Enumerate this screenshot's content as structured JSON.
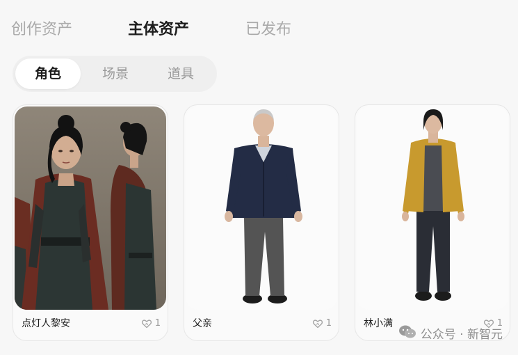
{
  "top_tabs": [
    {
      "label": "创作资产",
      "active": false
    },
    {
      "label": "主体资产",
      "active": true
    },
    {
      "label": "已发布",
      "active": false
    }
  ],
  "segments": [
    {
      "label": "角色",
      "active": true
    },
    {
      "label": "场景",
      "active": false
    },
    {
      "label": "道具",
      "active": false
    }
  ],
  "cards": [
    {
      "name": "点灯人黎安",
      "likes": "1",
      "icon": "heart-icon"
    },
    {
      "name": "父亲",
      "likes": "1",
      "icon": "heart-icon"
    },
    {
      "name": "林小满",
      "likes": "1",
      "icon": "heart-icon"
    }
  ],
  "watermark": {
    "text": "公众号 · 新智元",
    "icon": "wechat-logo"
  },
  "colors": {
    "background": "#f7f7f7",
    "active_text": "#1d1d1d",
    "inactive_text": "#a9a9a9",
    "segment_bg": "#efefef"
  }
}
